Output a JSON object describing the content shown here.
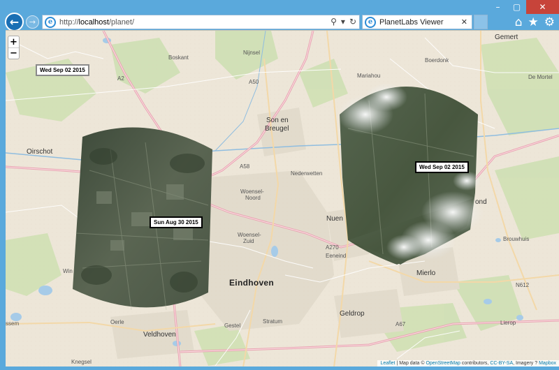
{
  "browser": {
    "url_prefix": "http://",
    "url_host": "localhost",
    "url_path": "/planet/",
    "tab_title": "PlanetLabs Viewer",
    "search_icon": "search-icon",
    "refresh_icon": "refresh-icon"
  },
  "map": {
    "zoom_in": "+",
    "zoom_out": "−",
    "labels": {
      "oirschot": "Oirschot",
      "boskant": "Boskant",
      "nijnsel": "Nijnsel",
      "boerdonk": "Boerdonk",
      "gemert": "Gemert",
      "de_mortel": "De Mortel",
      "mariahout": "Mariahou",
      "son_en": "Son en",
      "breugel": "Breugel",
      "nederwetten": "Nederwetten",
      "woensel_noord": "Woensel-",
      "woensel_noord2": "Noord",
      "woensel_zuid": "Woensel-",
      "woensel_zuid2": "Zuid",
      "nuenen": "Nuen",
      "eeneind": "Eeneind",
      "eindhoven": "Eindhoven",
      "mierlo": "Mierlo",
      "geldrop": "Geldrop",
      "veldhoven": "Veldhoven",
      "oerle": "Oerle",
      "gestel": "Gestel",
      "stratum": "Stratum",
      "knegsel": "Knegsel",
      "essem": "ssem",
      "win": "Win",
      "bakel": "ond",
      "brouwhuis": "Brouwhuis",
      "lierop": "Lierop",
      "a2": "A2",
      "a50": "A50",
      "a58": "A58",
      "a67": "A67",
      "a270": "A270",
      "n612": "N612"
    },
    "date_labels": {
      "topleft": "Wed Sep 02 2015",
      "left_scene": "Sun Aug 30 2015",
      "right_scene": "Wed Sep 02 2015"
    },
    "attribution": {
      "leaflet": "Leaflet",
      "text1": " | Map data © ",
      "osm": "OpenStreetMap",
      "text2": " contributors, ",
      "cc": "CC-BY-SA",
      "text3": ", Imagery ? ",
      "mapbox": "Mapbox"
    }
  },
  "colors": {
    "chrome": "#5aa9dc",
    "map_bg": "#ede6d8",
    "road": "#f6f1e6",
    "forest": "#c7dcae",
    "water": "#a6cbe8"
  }
}
